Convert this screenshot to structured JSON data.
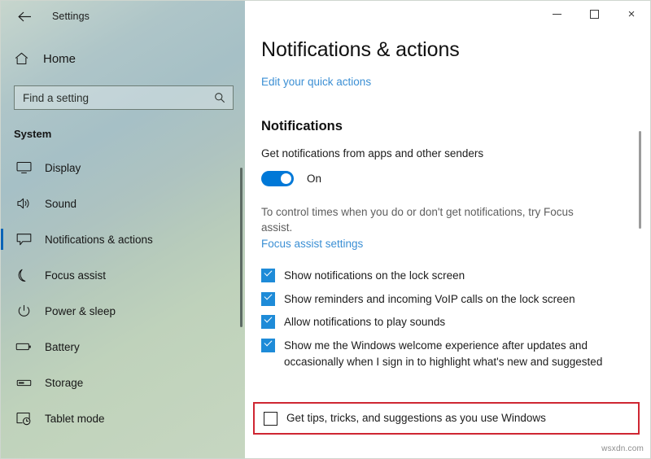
{
  "window": {
    "app_title": "Settings",
    "back_icon": "back-arrow-icon",
    "minimize_label": "–",
    "maximize_label": "□",
    "close_label": "×"
  },
  "sidebar": {
    "home_label": "Home",
    "home_icon": "home-icon",
    "search": {
      "placeholder": "Find a setting",
      "value": "",
      "icon": "search-icon"
    },
    "group_title": "System",
    "items": [
      {
        "label": "Display",
        "icon": "monitor-icon",
        "selected": false
      },
      {
        "label": "Sound",
        "icon": "speaker-icon",
        "selected": false
      },
      {
        "label": "Notifications & actions",
        "icon": "notification-icon",
        "selected": true
      },
      {
        "label": "Focus assist",
        "icon": "moon-icon",
        "selected": false
      },
      {
        "label": "Power & sleep",
        "icon": "power-icon",
        "selected": false
      },
      {
        "label": "Battery",
        "icon": "battery-icon",
        "selected": false
      },
      {
        "label": "Storage",
        "icon": "storage-icon",
        "selected": false
      },
      {
        "label": "Tablet mode",
        "icon": "tablet-mode-icon",
        "selected": false
      }
    ]
  },
  "main": {
    "page_title": "Notifications & actions",
    "quick_actions_link": "Edit your quick actions",
    "section_title": "Notifications",
    "toggle_setting": {
      "label": "Get notifications from apps and other senders",
      "state": "On",
      "enabled": true
    },
    "hint_text": "To control times when you do or don't get notifications, try Focus assist.",
    "focus_assist_link": "Focus assist settings",
    "checkboxes": [
      {
        "label": "Show notifications on the lock screen",
        "checked": true
      },
      {
        "label": "Show reminders and incoming VoIP calls on the lock screen",
        "checked": true
      },
      {
        "label": "Allow notifications to play sounds",
        "checked": true
      },
      {
        "label": "Show me the Windows welcome experience after updates and occasionally when I sign in to highlight what's new and suggested",
        "checked": true
      }
    ],
    "highlighted_checkbox": {
      "label": "Get tips, tricks, and suggestions as you use Windows",
      "checked": false
    }
  },
  "watermark": "wsxdn.com",
  "colors": {
    "accent_blue": "#0078d7",
    "checkbox_blue": "#1e8bd8",
    "link_blue": "#3b8fd4",
    "highlight_red": "#cf2632",
    "selection_bar": "#0a64b7"
  }
}
